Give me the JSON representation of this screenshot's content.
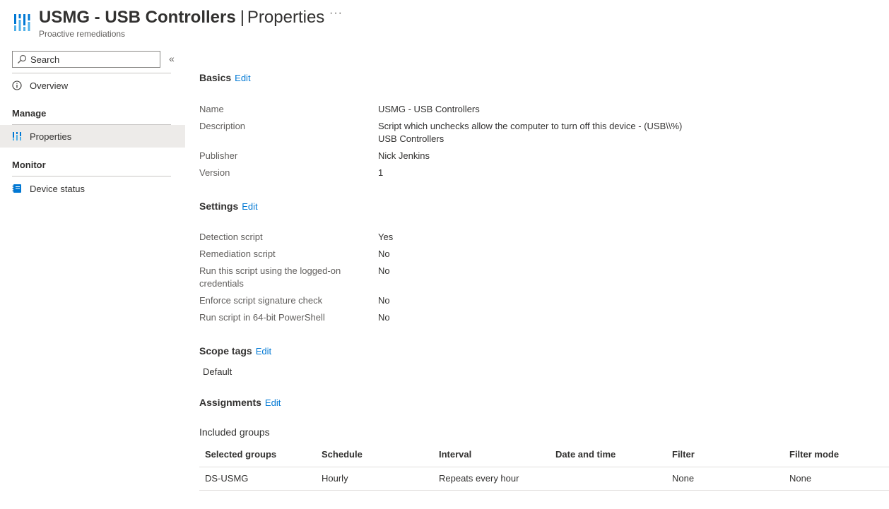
{
  "header": {
    "title": "USMG - USB Controllers",
    "separator": "|",
    "section": "Properties",
    "subtitle": "Proactive remediations",
    "more_label": "···"
  },
  "sidebar": {
    "search_placeholder": "Search",
    "collapse_label": "«",
    "items": [
      {
        "label": "Overview",
        "icon": "info-icon"
      },
      {
        "label": "Properties",
        "icon": "properties-icon",
        "active": true
      },
      {
        "label": "Device status",
        "icon": "device-status-icon"
      }
    ],
    "sections": {
      "manage": "Manage",
      "monitor": "Monitor"
    }
  },
  "basics": {
    "title": "Basics",
    "edit": "Edit",
    "rows": [
      {
        "label": "Name",
        "value": "USMG - USB Controllers"
      },
      {
        "label": "Description",
        "value": "Script which unchecks allow the computer to turn off this device - (USB\\\\%)",
        "value2": "USB Controllers"
      },
      {
        "label": "Publisher",
        "value": "Nick Jenkins"
      },
      {
        "label": "Version",
        "value": "1"
      }
    ]
  },
  "settings": {
    "title": "Settings",
    "edit": "Edit",
    "rows": [
      {
        "label": "Detection script",
        "value": "Yes"
      },
      {
        "label": "Remediation script",
        "value": "No"
      },
      {
        "label": "Run this script using the logged-on credentials",
        "value": "No"
      },
      {
        "label": "Enforce script signature check",
        "value": "No"
      },
      {
        "label": "Run script in 64-bit PowerShell",
        "value": "No"
      }
    ]
  },
  "scope_tags": {
    "title": "Scope tags",
    "edit": "Edit",
    "tags": [
      "Default"
    ]
  },
  "assignments": {
    "title": "Assignments",
    "edit": "Edit",
    "included_label": "Included groups",
    "columns": [
      "Selected groups",
      "Schedule",
      "Interval",
      "Date and time",
      "Filter",
      "Filter mode"
    ],
    "rows": [
      [
        "DS-USMG",
        "Hourly",
        "Repeats every hour",
        "",
        "None",
        "None"
      ]
    ]
  },
  "colors": {
    "link": "#0078d4",
    "brand_blue": "#0078d4",
    "brand_light": "#50b0e8",
    "active_bg": "#edebe9"
  }
}
